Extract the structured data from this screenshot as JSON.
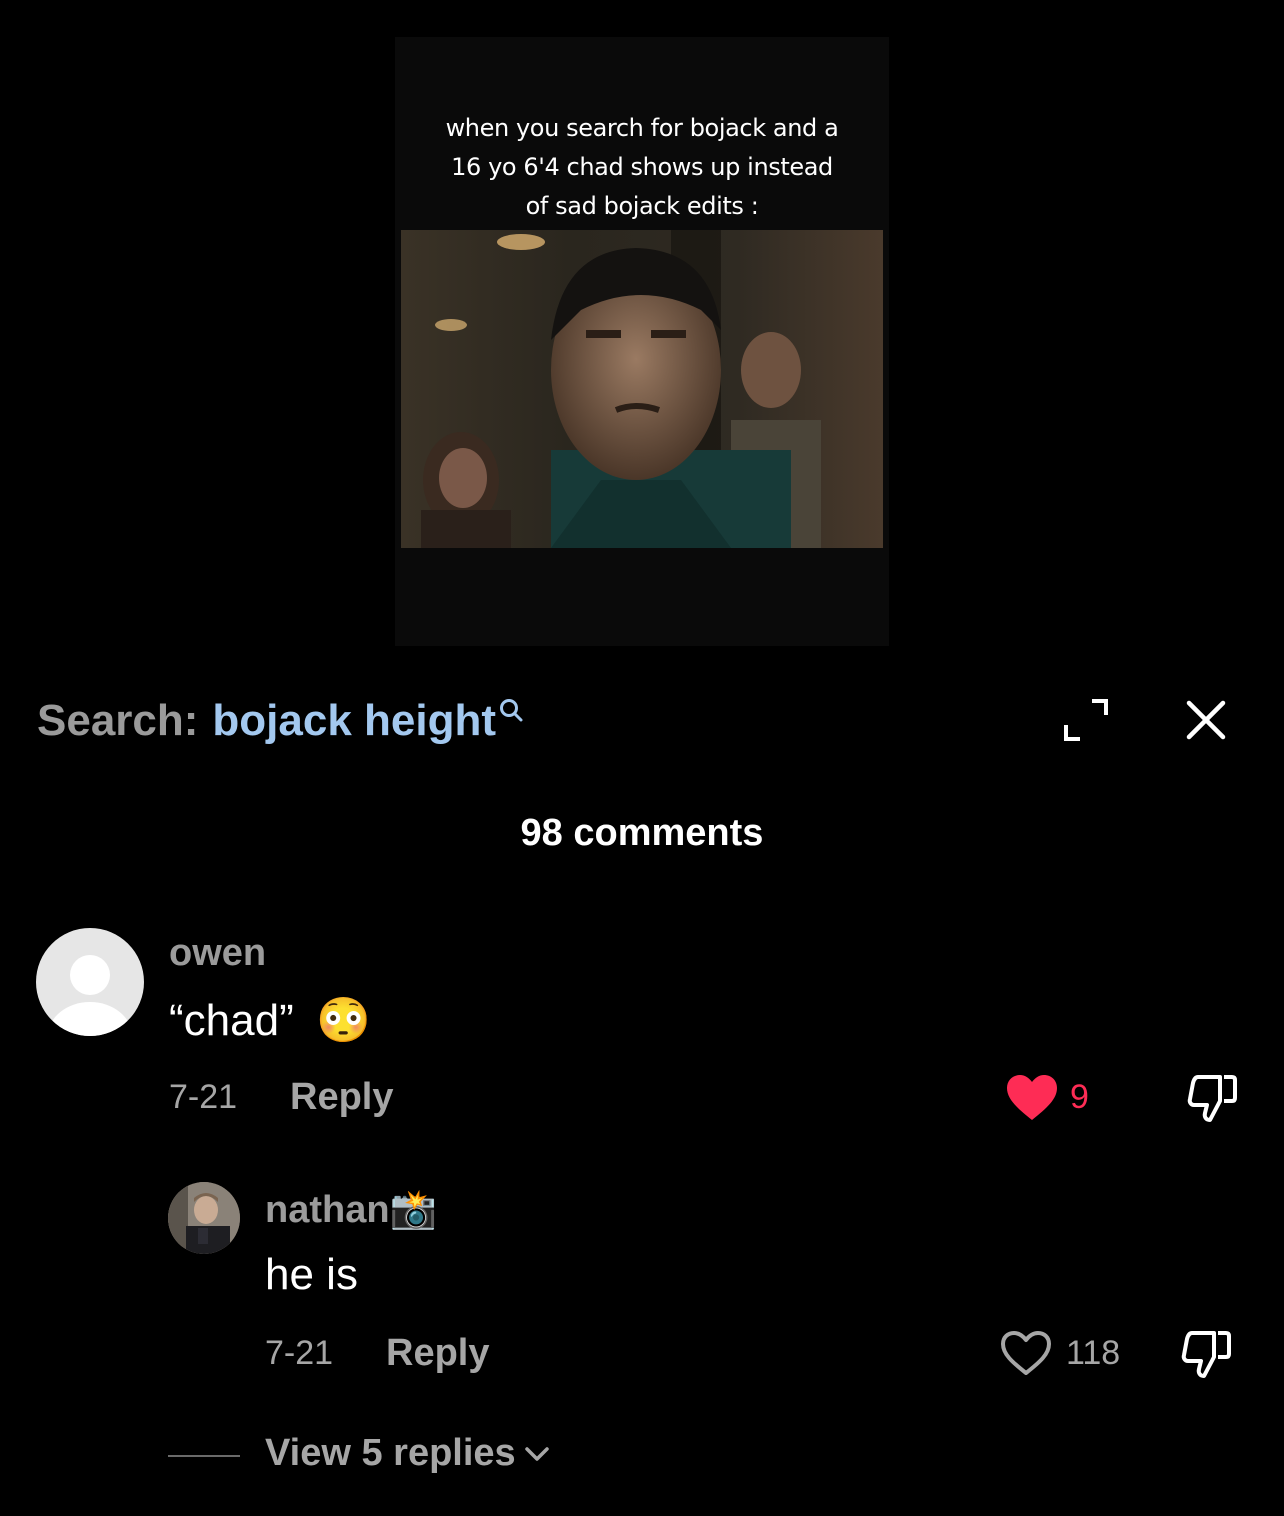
{
  "video": {
    "caption_lines": [
      "when you search for bojack and a",
      "16 yo 6'4 chad shows up instead",
      "of sad bojack edits :"
    ]
  },
  "search": {
    "label": "Search:",
    "term": "bojack height"
  },
  "comments_count": "98 comments",
  "comments": [
    {
      "username": "owen",
      "text": "“chad”",
      "emoji": "😳",
      "date": "7-21",
      "reply_label": "Reply",
      "likes": "9",
      "liked": true
    },
    {
      "username": "nathan",
      "username_emoji": "📸",
      "text": "he is",
      "date": "7-21",
      "reply_label": "Reply",
      "likes": "118",
      "liked": false
    }
  ],
  "view_replies": "View 5 replies",
  "colors": {
    "background": "#000000",
    "search_term": "#a3c8ef",
    "like_active": "#fe2c55",
    "muted_text": "#a6a6a6"
  },
  "icons": [
    "search-icon",
    "expand-icon",
    "close-icon",
    "heart-filled-icon",
    "heart-outline-icon",
    "dislike-icon",
    "chevron-down-icon"
  ]
}
